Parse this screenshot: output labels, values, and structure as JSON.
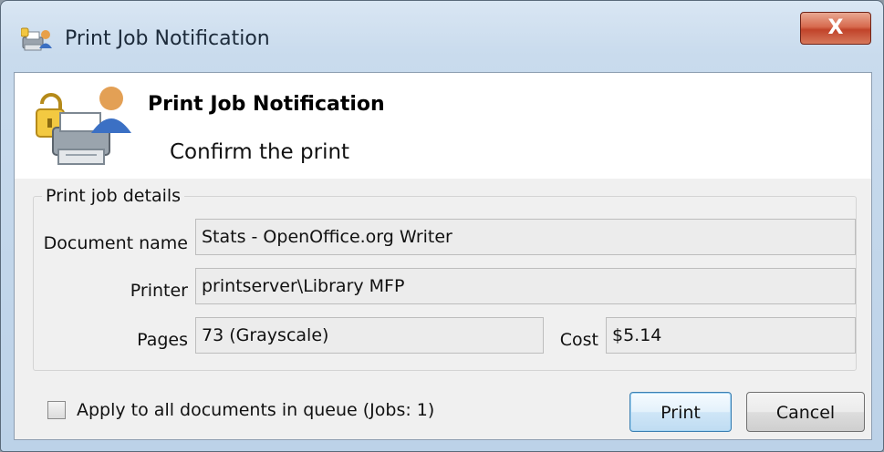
{
  "window": {
    "title": "Print Job Notification",
    "close_glyph": "X"
  },
  "header": {
    "title": "Print Job Notification",
    "subtitle": "Confirm the print",
    "icon": "printer-lock-user-icon"
  },
  "details": {
    "legend": "Print job details",
    "document_name_label": "Document name",
    "document_name_value": "Stats - OpenOffice.org Writer",
    "printer_label": "Printer",
    "printer_value": "printserver\\Library MFP",
    "pages_label": "Pages",
    "pages_value": "73   (Grayscale)",
    "cost_label": "Cost",
    "cost_value": "$5.14"
  },
  "footer": {
    "apply_all_label": "Apply to all documents in queue (Jobs: 1)",
    "apply_all_checked": false,
    "print_label": "Print",
    "cancel_label": "Cancel"
  },
  "colors": {
    "titlebar": "#c9dbed",
    "close_button": "#c1432a",
    "default_button_border": "#3c7fb1"
  }
}
